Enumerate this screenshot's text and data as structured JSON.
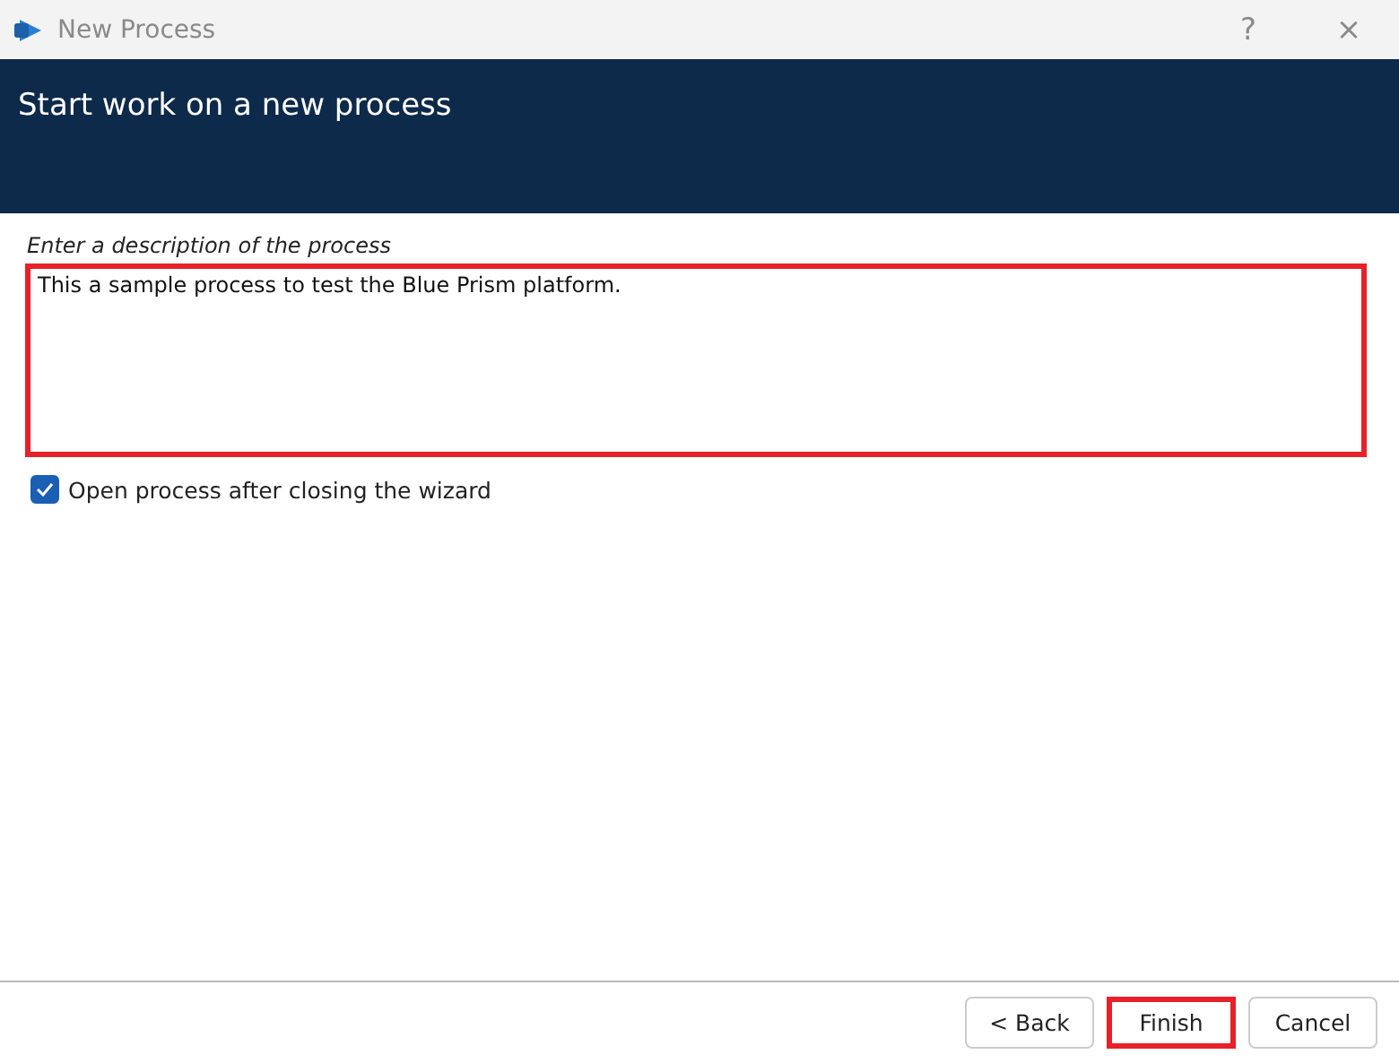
{
  "window": {
    "title": "New Process",
    "help": "?",
    "close": "×"
  },
  "header": {
    "title": "Start work on a new process"
  },
  "description": {
    "label": "Enter a description of the process",
    "value": "This a sample process to test the Blue Prism platform.",
    "highlighted": true
  },
  "open_after": {
    "label": "Open process after closing the wizard",
    "checked": true
  },
  "buttons": [
    {
      "label": "< Back",
      "highlighted": false
    },
    {
      "label": "Finish",
      "highlighted": true
    },
    {
      "label": "Cancel",
      "highlighted": false
    }
  ]
}
